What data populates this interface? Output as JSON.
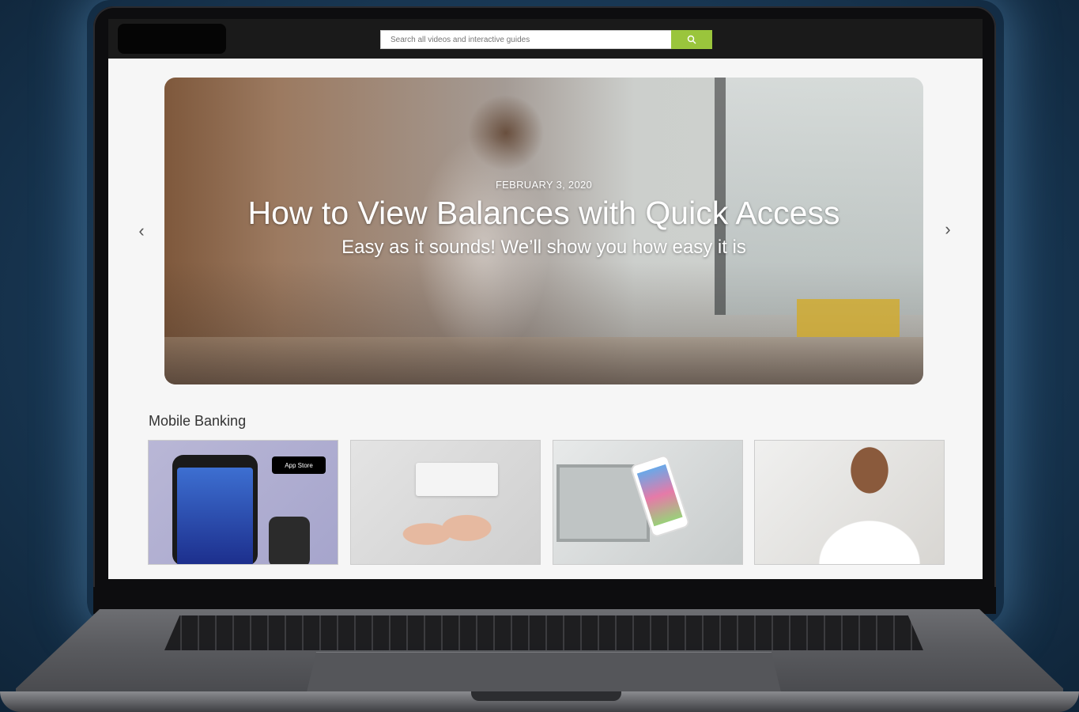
{
  "search": {
    "placeholder": "Search all videos and interactive guides",
    "button_icon": "search-icon"
  },
  "hero": {
    "date": "FEBRUARY 3, 2020",
    "title": "How to View Balances with Quick Access",
    "subtitle": "Easy as it sounds! We’ll show you how easy it is",
    "prev_icon": "chevron-left-icon",
    "next_icon": "chevron-right-icon"
  },
  "section": {
    "title": "Mobile Banking"
  },
  "cards": [
    {
      "image": "phone-and-watch-wallet",
      "badge": "App Store"
    },
    {
      "image": "hands-with-cards-and-keyboard"
    },
    {
      "image": "phone-in-hand-with-laptop"
    },
    {
      "image": "man-using-phone"
    }
  ],
  "colors": {
    "search_button": "#9ac53c",
    "topbar": "#1a1a1a",
    "background": "#1b3d5c"
  }
}
